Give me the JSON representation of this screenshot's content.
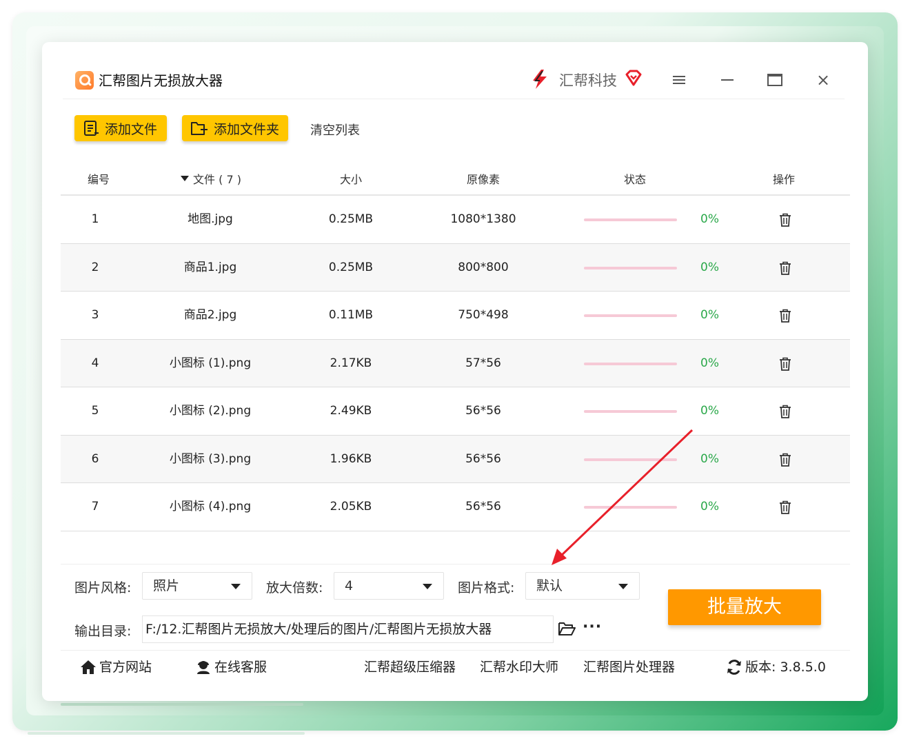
{
  "app": {
    "title": "汇帮图片无损放大器",
    "brand": "汇帮科技"
  },
  "toolbar": {
    "add_file": "添加文件",
    "add_folder": "添加文件夹",
    "clear_list": "清空列表"
  },
  "table": {
    "headers": {
      "index": "编号",
      "file": "文件 ( 7 )",
      "size": "大小",
      "pixels": "原像素",
      "status": "状态",
      "action": "操作"
    },
    "rows": [
      {
        "index": "1",
        "name": "地图.jpg",
        "size": "0.25MB",
        "pixels": "1080*1380",
        "progress": 0,
        "pct": "0%"
      },
      {
        "index": "2",
        "name": "商品1.jpg",
        "size": "0.25MB",
        "pixels": "800*800",
        "progress": 0,
        "pct": "0%"
      },
      {
        "index": "3",
        "name": "商品2.jpg",
        "size": "0.11MB",
        "pixels": "750*498",
        "progress": 0,
        "pct": "0%"
      },
      {
        "index": "4",
        "name": "小图标 (1).png",
        "size": "2.17KB",
        "pixels": "57*56",
        "progress": 0,
        "pct": "0%"
      },
      {
        "index": "5",
        "name": "小图标 (2).png",
        "size": "2.49KB",
        "pixels": "56*56",
        "progress": 0,
        "pct": "0%"
      },
      {
        "index": "6",
        "name": "小图标 (3).png",
        "size": "1.96KB",
        "pixels": "56*56",
        "progress": 0,
        "pct": "0%"
      },
      {
        "index": "7",
        "name": "小图标 (4).png",
        "size": "2.05KB",
        "pixels": "56*56",
        "progress": 0,
        "pct": "0%"
      }
    ]
  },
  "settings": {
    "style_label": "图片风格:",
    "style_value": "照片",
    "scale_label": "放大倍数:",
    "scale_value": "4",
    "format_label": "图片格式:",
    "format_value": "默认",
    "output_label": "输出目录:",
    "output_path": "F:/12.汇帮图片无损放大/处理后的图片/汇帮图片无损放大器",
    "more": "···",
    "batch_button": "批量放大"
  },
  "footer": {
    "website": "官方网站",
    "support": "在线客服",
    "link1": "汇帮超级压缩器",
    "link2": "汇帮水印大师",
    "link3": "汇帮图片处理器",
    "version": "版本: 3.8.5.0"
  },
  "colors": {
    "accent_yellow": "#ffc600",
    "batch_orange": "#ff9800",
    "progress_pink": "#f6c9d6",
    "percent_green": "#2ba84a",
    "annotation_red": "#e8202a"
  }
}
